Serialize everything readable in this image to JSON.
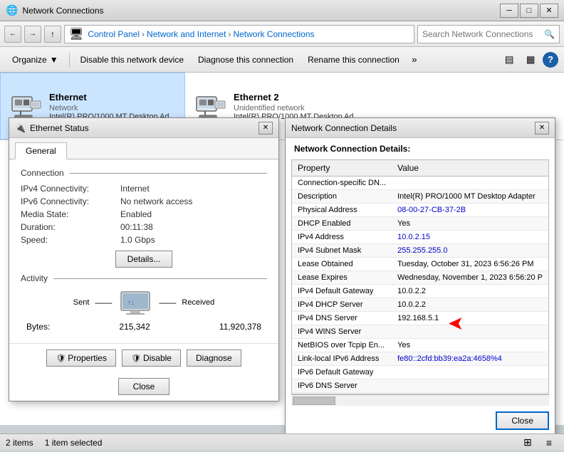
{
  "titleBar": {
    "icon": "🖥",
    "title": "Network Connections",
    "minBtn": "─",
    "maxBtn": "□",
    "closeBtn": "✕"
  },
  "addressBar": {
    "backBtn": "←",
    "forwardBtn": "→",
    "upBtn": "↑",
    "pathParts": [
      "Control Panel",
      "Network and Internet",
      "Network Connections"
    ],
    "searchPlaceholder": "Search Network Connections"
  },
  "toolbar": {
    "organizeBtn": "Organize",
    "organizeArrow": "▼",
    "disableBtn": "Disable this network device",
    "diagnoseBtn": "Diagnose this connection",
    "renameBtn": "Rename this connection",
    "moreBtn": "»"
  },
  "networkItems": [
    {
      "name": "Ethernet",
      "type": "Network",
      "desc": "Intel(R) PRO/1000 MT Desktop Ad...",
      "selected": true
    },
    {
      "name": "Ethernet 2",
      "type": "Unidentified network",
      "desc": "Intel(R) PRO/1000 MT Desktop Ad...",
      "selected": false
    }
  ],
  "ethernetDialog": {
    "title": "Ethernet Status",
    "tab": "General",
    "connection": {
      "label": "Connection",
      "ipv4Label": "IPv4 Connectivity:",
      "ipv4Value": "Internet",
      "ipv6Label": "IPv6 Connectivity:",
      "ipv6Value": "No network access",
      "mediaLabel": "Media State:",
      "mediaValue": "Enabled",
      "durationLabel": "Duration:",
      "durationValue": "00:11:38",
      "speedLabel": "Speed:",
      "speedValue": "1.0 Gbps"
    },
    "detailsBtn": "Details...",
    "activity": {
      "label": "Activity",
      "sentLabel": "Sent",
      "receivedLabel": "Received",
      "bytesLabel": "Bytes:",
      "sentBytes": "215,342",
      "receivedBytes": "11,920,378"
    },
    "buttons": {
      "properties": "Properties",
      "disable": "Disable",
      "diagnose": "Diagnose"
    },
    "closeBtn": "Close"
  },
  "detailsDialog": {
    "title": "Network Connection Details",
    "sectionLabel": "Network Connection Details:",
    "colProperty": "Property",
    "colValue": "Value",
    "rows": [
      {
        "property": "Connection-specific DN...",
        "value": ""
      },
      {
        "property": "Description",
        "value": "Intel(R) PRO/1000 MT Desktop Adapter"
      },
      {
        "property": "Physical Address",
        "value": "08-00-27-CB-37-2B",
        "highlight": true
      },
      {
        "property": "DHCP Enabled",
        "value": "Yes"
      },
      {
        "property": "IPv4 Address",
        "value": "10.0.2.15",
        "highlight": true
      },
      {
        "property": "IPv4 Subnet Mask",
        "value": "255.255.255.0",
        "highlight": true
      },
      {
        "property": "Lease Obtained",
        "value": "Tuesday, October 31, 2023 6:56:26 PM"
      },
      {
        "property": "Lease Expires",
        "value": "Wednesday, November 1, 2023 6:56:20 P"
      },
      {
        "property": "IPv4 Default Gateway",
        "value": "10.0.2.2"
      },
      {
        "property": "IPv4 DHCP Server",
        "value": "10.0.2.2"
      },
      {
        "property": "IPv4 DNS Server",
        "value": "192.168.5.1"
      },
      {
        "property": "IPv4 WINS Server",
        "value": ""
      },
      {
        "property": "NetBIOS over Tcpip En...",
        "value": "Yes"
      },
      {
        "property": "Link-local IPv6 Address",
        "value": "fe80::2cfd:bb39:ea2a:4658%4",
        "highlight": true
      },
      {
        "property": "IPv6 Default Gateway",
        "value": ""
      },
      {
        "property": "IPv6 DNS Server",
        "value": ""
      }
    ],
    "closeBtn": "Close"
  },
  "statusBar": {
    "itemCount": "2 items",
    "selectedCount": "1 item selected"
  }
}
